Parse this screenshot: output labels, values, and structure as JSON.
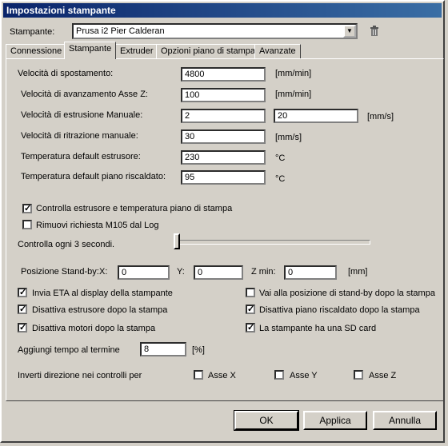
{
  "window": {
    "title": "Impostazioni stampante"
  },
  "printer": {
    "label": "Stampante:",
    "value": "Prusa i2 Pier Calderan"
  },
  "tabs": [
    {
      "label": "Connessione"
    },
    {
      "label": "Stampante",
      "active": true
    },
    {
      "label": "Extruder"
    },
    {
      "label": "Opzioni piano di stampa"
    },
    {
      "label": "Avanzate"
    }
  ],
  "fields": {
    "travel_speed": {
      "label": "Velocità di spostamento:",
      "value": "4800",
      "unit": "[mm/min]"
    },
    "z_speed": {
      "label": "Velocità di avanzamento Asse Z:",
      "value": "100",
      "unit": "[mm/min]"
    },
    "manual_extrusion": {
      "label": "Velocità di estrusione Manuale:",
      "value1": "2",
      "value2": "20",
      "unit": "[mm/s]"
    },
    "manual_retraction": {
      "label": "Velocità di ritrazione manuale:",
      "value": "30",
      "unit": "[mm/s]"
    },
    "extruder_temp": {
      "label": "Temperatura default estrusore:",
      "value": "230",
      "unit": "°C"
    },
    "bed_temp": {
      "label": "Temperatura default piano riscaldato:",
      "value": "95",
      "unit": "°C"
    }
  },
  "checks": {
    "monitor_temp": {
      "label": "Controlla estrusore e temperatura piano di stampa",
      "checked": true
    },
    "remove_m105": {
      "label": "Rimuovi richiesta M105 dal Log",
      "checked": false
    }
  },
  "interval": {
    "label": "Controlla ogni 3 secondi.",
    "level": 0
  },
  "standby": {
    "label": "Posizione Stand-by:",
    "x_label": "X:",
    "x_value": "0",
    "y_label": "Y:",
    "y_value": "0",
    "z_label": "Z min:",
    "z_value": "0",
    "unit": "[mm]"
  },
  "options": {
    "send_eta": {
      "label": "Invia ETA al display della stampante",
      "checked": true
    },
    "goto_standby": {
      "label": "Vai alla posizione di stand-by dopo la stampa",
      "checked": false
    },
    "disable_extruder": {
      "label": "Disattiva estrusore dopo la stampa",
      "checked": true
    },
    "disable_bed": {
      "label": "Disattiva piano riscaldato dopo la stampa",
      "checked": true
    },
    "disable_motors": {
      "label": "Disattiva motori dopo la stampa",
      "checked": true
    },
    "has_sd": {
      "label": "La stampante ha una SD card",
      "checked": true
    }
  },
  "add_time": {
    "label": "Aggiungi tempo al termine",
    "value": "8",
    "unit": "[%]"
  },
  "invert": {
    "label": "Inverti direzione nei controlli per",
    "x": {
      "label": "Asse X",
      "checked": false
    },
    "y": {
      "label": "Asse Y",
      "checked": false
    },
    "z": {
      "label": "Asse Z",
      "checked": false
    }
  },
  "buttons": {
    "ok": "OK",
    "apply": "Applica",
    "cancel": "Annulla"
  },
  "icons": {
    "delete": "trash-icon",
    "dropdown": "chevron-down-icon",
    "check": "checkmark-icon"
  }
}
